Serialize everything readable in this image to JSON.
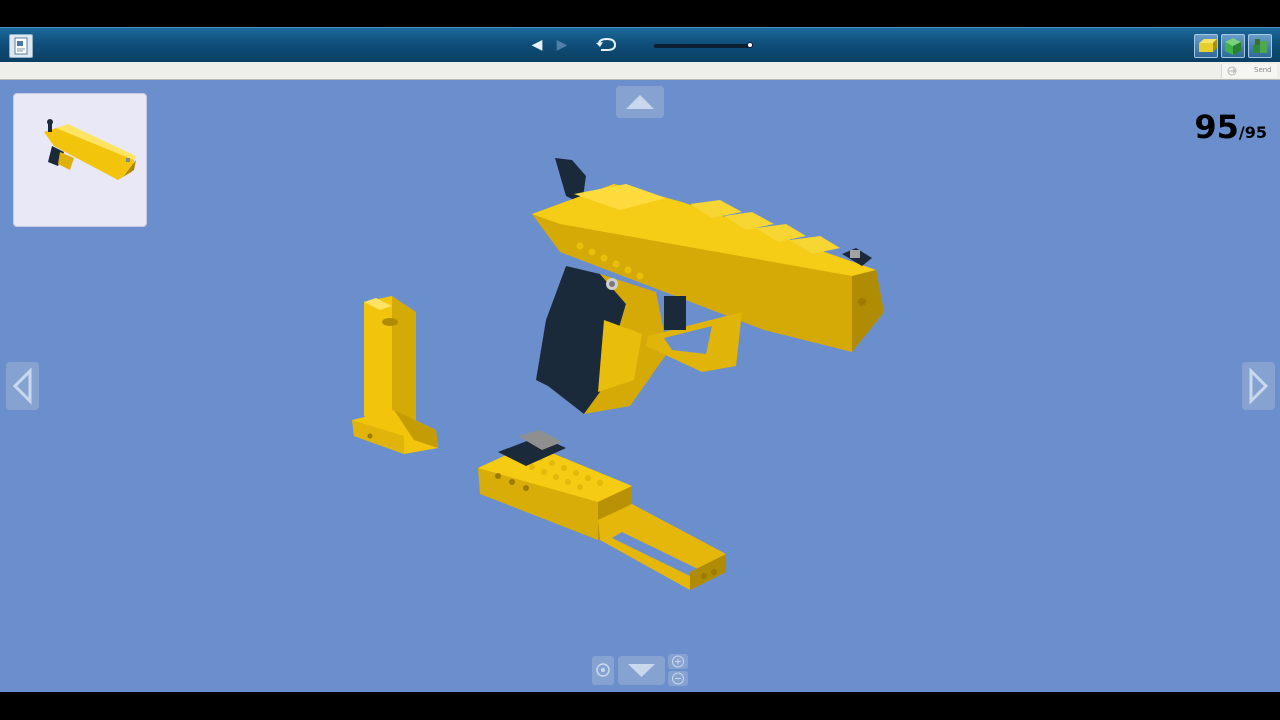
{
  "toolbar": {
    "doc_icon": "document-icon",
    "back_icon": "triangle-left-icon",
    "forward_icon": "triangle-right-icon",
    "rotate_icon": "rotate-icon",
    "progress_fraction": 1.0,
    "view_buttons": [
      "view-model-icon",
      "view-bricks-icon",
      "view-grid-icon"
    ]
  },
  "subbar": {
    "send_label": "Send"
  },
  "step": {
    "current": "95",
    "separator": "/",
    "total": "95"
  },
  "colors": {
    "background": "#6a8fcc",
    "brick_yellow": "#f2c40b",
    "brick_black": "#1b2a3a",
    "brick_grey": "#9a9a9a",
    "toolbar": "#0f4f7a"
  }
}
